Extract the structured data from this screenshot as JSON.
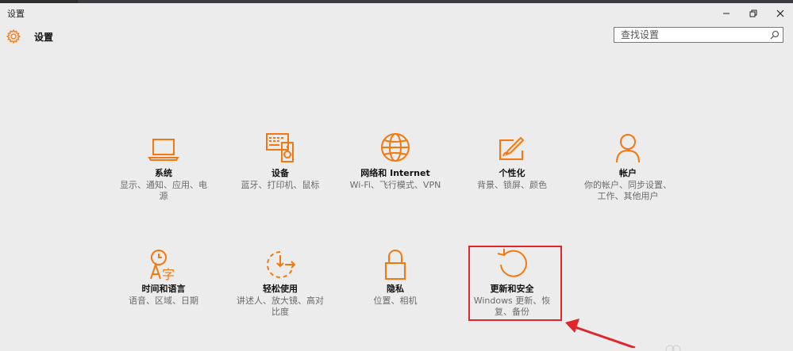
{
  "window": {
    "title": "设置",
    "controls": {
      "minimize": "minimize-icon",
      "maximize": "restore-icon",
      "close": "close-icon"
    }
  },
  "header": {
    "title": "设置",
    "icon": "gear-icon"
  },
  "search": {
    "placeholder": "查找设置",
    "icon": "search-icon"
  },
  "accent_color": "#f4780d",
  "annotation_color": "#e0262c",
  "tiles": [
    {
      "name": "系统",
      "desc": "显示、通知、应用、电源",
      "icon": "laptop-icon"
    },
    {
      "name": "设备",
      "desc": "蓝牙、打印机、鼠标",
      "icon": "devices-icon"
    },
    {
      "name": "网络和 Internet",
      "desc": "Wi-Fi、飞行模式、VPN",
      "icon": "globe-icon"
    },
    {
      "name": "个性化",
      "desc": "背景、锁屏、颜色",
      "icon": "paint-icon"
    },
    {
      "name": "帐户",
      "desc": "你的帐户、同步设置、工作、其他用户",
      "icon": "person-icon"
    },
    {
      "name": "时间和语言",
      "desc": "语音、区域、日期",
      "icon": "time-language-icon"
    },
    {
      "name": "轻松使用",
      "desc": "讲述人、放大镜、高对比度",
      "icon": "ease-of-access-icon"
    },
    {
      "name": "隐私",
      "desc": "位置、相机",
      "icon": "lock-icon"
    },
    {
      "name": "更新和安全",
      "desc": "Windows 更新、恢复、备份",
      "icon": "update-icon"
    }
  ]
}
